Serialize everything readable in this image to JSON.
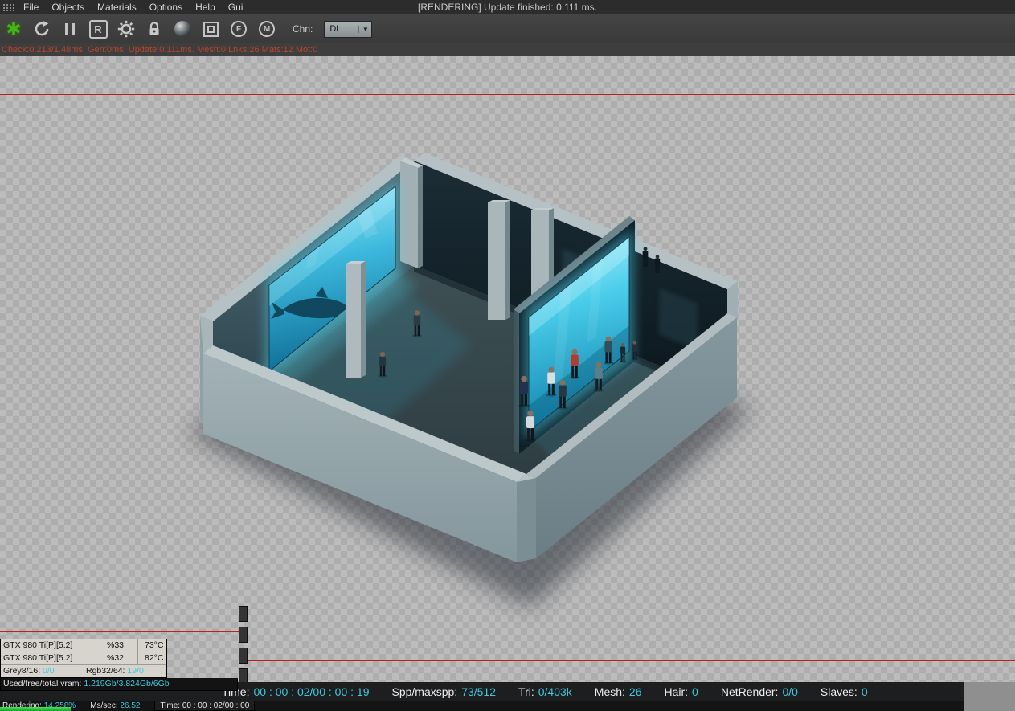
{
  "menubar": {
    "items": [
      "File",
      "Objects",
      "Materials",
      "Options",
      "Help",
      "Gui"
    ],
    "status": "[RENDERING] Update finished: 0.111 ms."
  },
  "toolbar": {
    "icons": [
      "render-start",
      "restart-render",
      "pause-render",
      "reset",
      "settings-gear",
      "lock",
      "material-sphere",
      "region-render",
      "pick-focus",
      "pick-material",
      "channel-dropdown"
    ],
    "reset_label": "R",
    "pin_f": "F",
    "pin_m": "M",
    "channel_label": "Chn:",
    "channel_value": "DL"
  },
  "stats_line": {
    "text": "Check:0.213/1.48ms. Gen:0ms. Update:0.111ms. Mesh:0 Lnks:26 Mats:12 Mot:0",
    "color": "#bb452a"
  },
  "gpu_panel": {
    "rows": [
      {
        "name": "GTX 980 Ti[P][5.2]",
        "load": "%33",
        "temp": "73°C"
      },
      {
        "name": "GTX 980 Ti[P][5.2]",
        "load": "%32",
        "temp": "82°C"
      }
    ],
    "buffers": {
      "grey_label": "Grey8/16:",
      "grey_value": "0/0",
      "rgb_label": "Rgb32/64:",
      "rgb_value": "19/0"
    },
    "vram_label": "Used/free/total vram:",
    "vram_value": "1.219Gb/3.824Gb/6Gb"
  },
  "status_bar": {
    "items": [
      {
        "label": "Time:",
        "value": "00 : 00 : 02/00 : 00 : 19"
      },
      {
        "label": "Spp/maxspp:",
        "value": "73/512"
      },
      {
        "label": "Tri:",
        "value": "0/403k"
      },
      {
        "label": "Mesh:",
        "value": "26"
      },
      {
        "label": "Hair:",
        "value": "0"
      },
      {
        "label": "NetRender:",
        "value": "0/0"
      },
      {
        "label": "Slaves:",
        "value": "0"
      }
    ]
  },
  "progress_bar": {
    "items": [
      {
        "label": "Rendering:",
        "value": "14.258%"
      },
      {
        "label": "Ms/sec:",
        "value": "26.52"
      },
      {
        "label": "Time:",
        "value": "00 : 00 : 02/00 : 00"
      }
    ],
    "percent": 14.258,
    "bar_color": "#2ecc40"
  },
  "colors": {
    "value_cyan": "#3fc9dd",
    "profiler_red": "#bb452a",
    "region_line_red": "#c01010",
    "screen_cyan": "#49cdea",
    "progress_green": "#2ecc40"
  },
  "scene": {
    "description": "Isometric render of a two-room exhibition space with two glowing cyan video walls, gray concrete walls, columns and small human figures, on an alpha-transparency checkerboard background"
  }
}
